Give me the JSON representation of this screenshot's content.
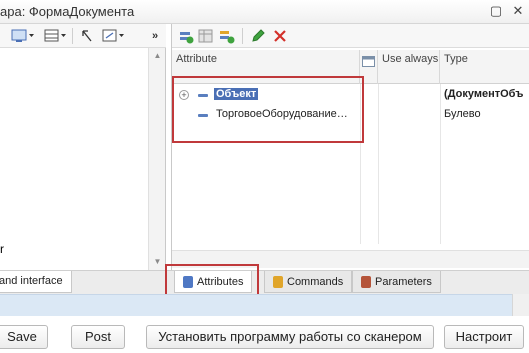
{
  "window": {
    "title": "ара: ФормаДокумента"
  },
  "left_panel": {
    "partial_text": "r",
    "tab_label": "and interface"
  },
  "right_panel": {
    "columns": {
      "attribute": "Attribute",
      "use_always": "Use always",
      "type": "Type"
    },
    "rows": [
      {
        "name": "Объект",
        "type": "(ДокументОбъ",
        "selected": true,
        "expandable": true
      },
      {
        "name": "ТорговоеОборудование…",
        "type": "Булево",
        "selected": false,
        "expandable": false
      }
    ]
  },
  "tabs": [
    {
      "label": "Attributes",
      "active": true,
      "icon_color": "#4f78c4"
    },
    {
      "label": "Commands",
      "active": false,
      "icon_color": "#e0a52a"
    },
    {
      "label": "Parameters",
      "active": false,
      "icon_color": "#b5543a"
    }
  ],
  "buttons": {
    "save": "Save",
    "post": "Post",
    "scanner": "Установить программу работы со сканером",
    "configure": "Настроит"
  },
  "colors": {
    "highlight_box": "#c0393b",
    "selection": "#4a6fb5",
    "lower_band": "#dbe8f5"
  }
}
